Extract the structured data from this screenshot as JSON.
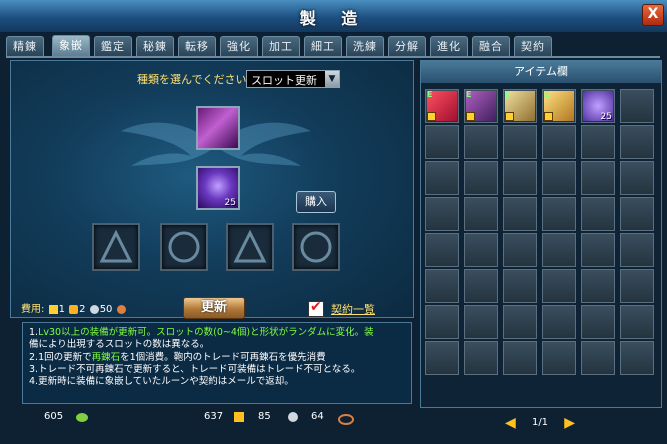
{
  "window": {
    "title": "製 造",
    "close_label": "X"
  },
  "tabs": [
    {
      "label": "精錬"
    },
    {
      "label": "象嵌"
    },
    {
      "label": "鑑定"
    },
    {
      "label": "秘錬"
    },
    {
      "label": "転移"
    },
    {
      "label": "強化"
    },
    {
      "label": "加工"
    },
    {
      "label": "細工"
    },
    {
      "label": "洗練"
    },
    {
      "label": "分解"
    },
    {
      "label": "進化"
    },
    {
      "label": "融合"
    },
    {
      "label": "契約"
    }
  ],
  "active_tab": "象嵌",
  "type_select": {
    "label": "種類を選んでください",
    "value": "スロット更新"
  },
  "slots": {
    "gem_qty": "25"
  },
  "buttons": {
    "buy": "購入",
    "update": "更新"
  },
  "cost": {
    "label": "費用:",
    "v1": "1",
    "v2": "2",
    "v3": "50"
  },
  "contract": {
    "label": "契約一覧",
    "checked": true
  },
  "notes": {
    "l1a": "1.",
    "l1b": "Lv30",
    "l1c": "以上の装備が更新可。",
    "l1d": "スロットの数(0~4個)と形状がランダムに変化。装",
    "l2": "備により出現するスロットの数は異なる。",
    "l3a": "2.1回の更新で",
    "l3b": "再錬石",
    "l3c": "を1個消費。鞄内のトレード可再錬石を優先消費",
    "l4": "3.トレード不可再錬石で更新すると、トレード可装備はトレード不可となる。",
    "l5": "4.更新時に装備に象嵌していたルーンや契約はメールで返却。"
  },
  "currency": {
    "c1": "605",
    "c2": "637",
    "c3": "85",
    "c4": "64"
  },
  "inventory": {
    "header": "アイテム欄",
    "items": [
      {
        "icon": "red-weapon-icon",
        "qty": ""
      },
      {
        "icon": "purple-weapon-icon",
        "qty": ""
      },
      {
        "icon": "gold-weapon-icon",
        "qty": ""
      },
      {
        "icon": "gold-armor-icon",
        "qty": ""
      },
      {
        "icon": "gem-icon",
        "qty": "25"
      }
    ],
    "page": "1/1"
  },
  "colors": {
    "accent": "#ffe070",
    "highlight": "#80ff40"
  }
}
